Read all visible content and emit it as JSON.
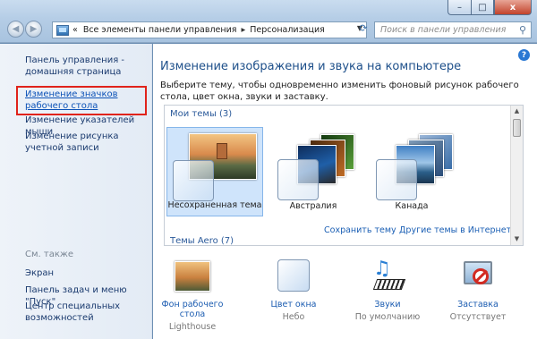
{
  "window": {
    "buttons": {
      "minimize": "–",
      "maximize": "□",
      "close": "x"
    }
  },
  "address": {
    "root": "«",
    "crumbs": [
      "Все элементы панели управления",
      "Персонализация"
    ]
  },
  "search": {
    "placeholder": "Поиск в панели управления"
  },
  "sidebar": {
    "items": [
      {
        "label": "Панель управления - домашняя страница"
      },
      {
        "label": "Изменение значков рабочего стола"
      },
      {
        "label": "Изменение указателей мыши"
      },
      {
        "label": "Изменение рисунка учетной записи"
      }
    ],
    "see_also_title": "См. также",
    "see_also": [
      {
        "label": "Экран"
      },
      {
        "label": "Панель задач и меню \"Пуск\""
      },
      {
        "label": "Центр специальных возможностей"
      }
    ]
  },
  "main": {
    "title": "Изменение изображения и звука на компьютере",
    "description": "Выберите тему, чтобы одновременно изменить фоновый рисунок рабочего стола, цвет окна, звуки и заставку.",
    "groups": {
      "my": "Мои темы (3)",
      "aero": "Темы Aero (7)"
    },
    "themes": [
      {
        "label": "Несохраненная тема",
        "selected": true
      },
      {
        "label": "Австралия",
        "selected": false
      },
      {
        "label": "Канада",
        "selected": false
      }
    ],
    "links": {
      "save": "Сохранить тему",
      "online": "Другие темы в Интернете"
    },
    "settings": [
      {
        "name": "Фон рабочего стола",
        "value": "Lighthouse",
        "icon": "desktop-background-icon"
      },
      {
        "name": "Цвет окна",
        "value": "Небо",
        "icon": "window-color-icon"
      },
      {
        "name": "Звуки",
        "value": "По умолчанию",
        "icon": "sounds-icon"
      },
      {
        "name": "Заставка",
        "value": "Отсутствует",
        "icon": "screensaver-icon"
      }
    ]
  },
  "colors": {
    "selection_red": "#e0231b",
    "link": "#1b5fb4",
    "title": "#1d4f8a"
  }
}
